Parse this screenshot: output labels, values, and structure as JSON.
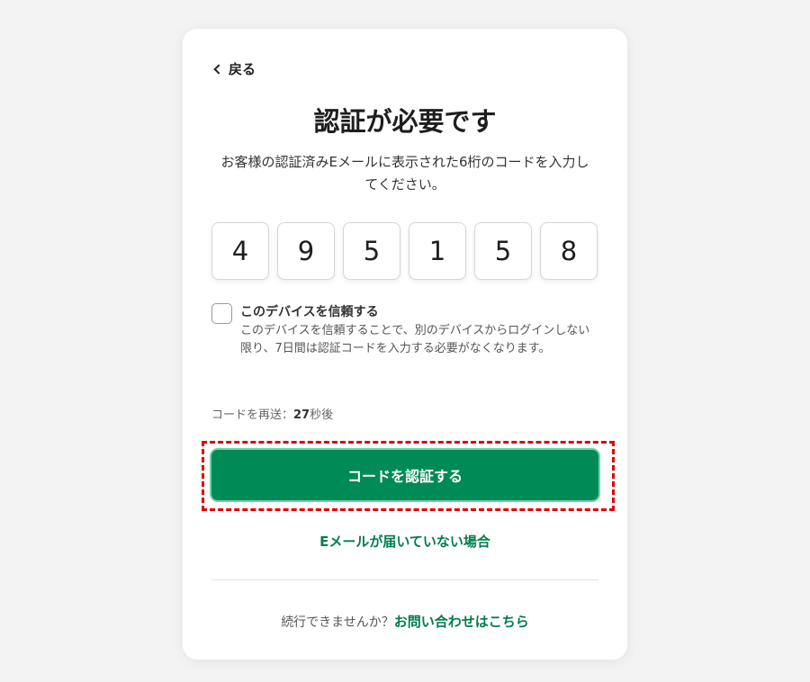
{
  "nav": {
    "back_label": "戻る"
  },
  "heading": {
    "title": "認証が必要です"
  },
  "description": "お客様の認証済みEメールに表示された6桁のコードを入力してください。",
  "code_digits": [
    "4",
    "9",
    "5",
    "1",
    "5",
    "8"
  ],
  "trust_device": {
    "label": "このデバイスを信頼する",
    "description": "このデバイスを信頼することで、別のデバイスからログインしない限り、7日間は認証コードを入力する必要がなくなります。",
    "checked": false
  },
  "resend": {
    "prefix": "コードを再送：",
    "seconds": "27",
    "suffix": "秒後"
  },
  "actions": {
    "verify_label": "コードを認証する",
    "no_email_label": "Eメールが届いていない場合"
  },
  "footer": {
    "prompt": "続行できませんか？",
    "contact_label": "お問い合わせはこちら"
  },
  "colors": {
    "primary_green": "#008a55",
    "link_green": "#007d4c",
    "highlight_red": "#e00000"
  }
}
